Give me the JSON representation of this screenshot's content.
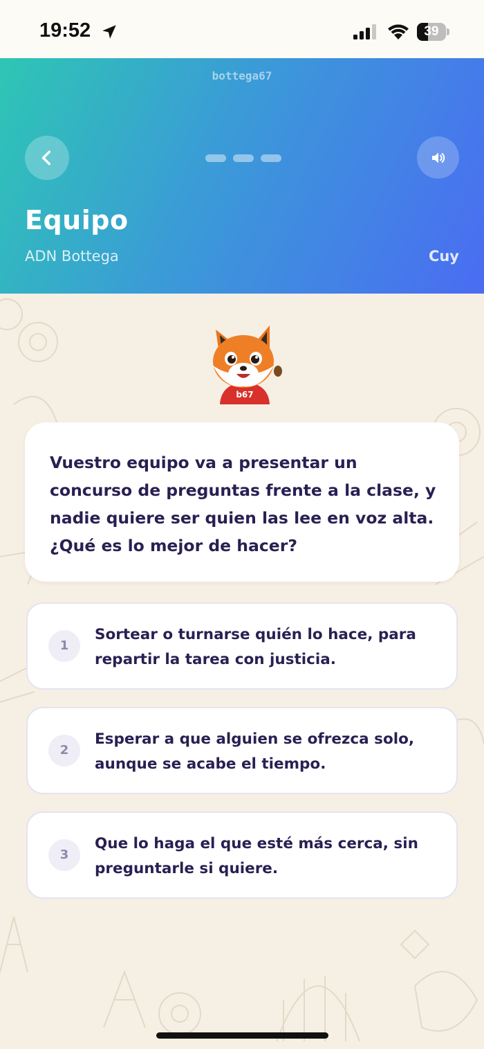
{
  "status_bar": {
    "time": "19:52",
    "battery_text": "39",
    "battery_level": 0.39
  },
  "header": {
    "brand": "bottega67",
    "title": "Equipo",
    "subtitle": "ADN Bottega",
    "author": "Cuy",
    "progress_steps": 3,
    "gradient_colors": [
      "#2ec6b4",
      "#3b9ad8",
      "#4a6cf2"
    ]
  },
  "mascot": {
    "icon": "fox-mascot",
    "shirt_text": "b67"
  },
  "question": {
    "text": "Vuestro equipo va a presentar un concurso de preguntas frente a la clase, y nadie quiere ser quien las lee en voz alta. ¿Qué es lo mejor de hacer?"
  },
  "options": [
    {
      "number": "1",
      "text": "Sortear o turnarse quién lo hace, para repartir la tarea con justicia."
    },
    {
      "number": "2",
      "text": "Esperar a que alguien se ofrezca solo, aunque se acabe el tiempo."
    },
    {
      "number": "3",
      "text": "Que lo haga el que esté más cerca, sin preguntarle si quiere."
    }
  ],
  "colors": {
    "text_dark": "#2a1f52",
    "background": "#f6efe4",
    "card": "#ffffff",
    "option_border": "#e4e3f2"
  }
}
